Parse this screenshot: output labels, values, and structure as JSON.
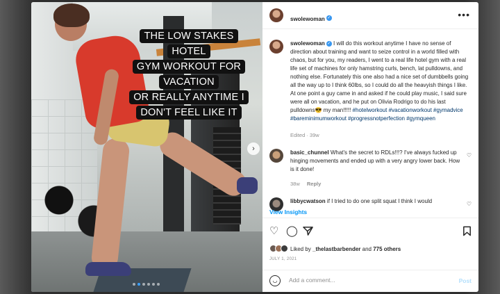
{
  "post": {
    "caption_overlay": [
      "THE LOW STAKES HOTEL",
      "GYM WORKOUT FOR",
      "VACATION",
      "OR REALLY ANYTIME I",
      "DON'T FEEL LIKE IT"
    ],
    "carousel_next_glyph": "›",
    "carousel_slide_count": 6,
    "carousel_active_index": 1
  },
  "header": {
    "username": "swolewoman",
    "verified_glyph": "✓",
    "more_glyph": "•••"
  },
  "caption": {
    "username": "swolewoman",
    "text": "I will do this workout anytime I have no sense of direction about training and want to seize control in a world filled with chaos, but for you, my readers, I went to a real life hotel gym with a real life set of machines for only hamstring curls, bench, lat pulldowns, and nothing else. Fortunately this one also had a nice set of dumbbells going all the way up to I think 60lbs, so I could do all the heavyish things I like. At one point a guy came in and asked if he could play music, I said sure were all on vacation, and he put on Olivia Rodrigo to do his last pulldowns😎 my man!!!!! ",
    "hashtags": "#hotelworkout #vacationworkout #gymadvice #bareminimumworkout #progressnotperfection #gymqueen",
    "edited": "Edited · 39w"
  },
  "comments": [
    {
      "username": "basic_chunnel",
      "text": "What's the secret to RDLs!!!? I've always fucked up hinging movements and ended up with a very angry lower back. How is it done!",
      "age": "38w",
      "reply": "Reply"
    },
    {
      "username": "libbycwatson",
      "text": "if I tried to do one split squat I think I would"
    }
  ],
  "view_insights": "View Insights",
  "actions": {
    "like_icon": "heart-icon",
    "comment_icon": "comment-icon",
    "share_icon": "paper-plane-icon",
    "save_icon": "bookmark-icon"
  },
  "likes": {
    "prefix": "Liked by ",
    "user": "_thelastbarbender",
    "middle": " and ",
    "count": "775 others"
  },
  "date": "JULY 1, 2021",
  "composer": {
    "placeholder": "Add a comment...",
    "post_label": "Post",
    "emoji_icon": "emoji-icon"
  }
}
